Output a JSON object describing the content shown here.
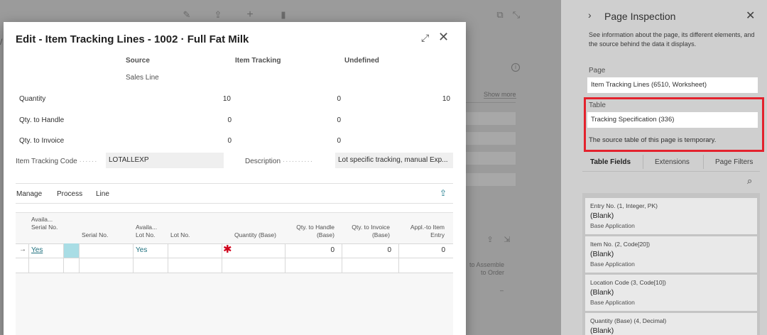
{
  "dialog": {
    "title": "Edit - Item Tracking Lines - 1002 · Full Fat Milk",
    "columns": {
      "source": "Source",
      "source_sub": "Sales Line",
      "item_tracking": "Item Tracking",
      "undefined": "Undefined"
    },
    "rows": [
      {
        "label": "Quantity",
        "source": "10",
        "item_tracking": "0",
        "undefined": "10"
      },
      {
        "label": "Qty. to Handle",
        "source": "0",
        "item_tracking": "0"
      },
      {
        "label": "Qty. to Invoice",
        "source": "0",
        "item_tracking": "0"
      }
    ],
    "item_tracking_code_label": "Item Tracking Code",
    "item_tracking_code_value": "LOTALLEXP",
    "description_label": "Description",
    "description_value": "Lot specific tracking, manual Exp...",
    "menu": [
      "Manage",
      "Process",
      "Line"
    ],
    "grid": {
      "headers": {
        "avail_serial": "Availa... Serial No.",
        "serial_no": "Serial No.",
        "avail_lot": "Availa... Lot No.",
        "lot_no": "Lot No.",
        "quantity_base": "Quantity (Base)",
        "qty_handle_base": "Qty. to Handle (Base)",
        "qty_invoice_base": "Qty. to Invoice (Base)",
        "appl_to_item_entry": "Appl.-to Item Entry"
      },
      "row1": {
        "avail_serial": "Yes",
        "avail_lot": "Yes",
        "qty_handle_base": "0",
        "qty_invoice_base": "0",
        "appl_to_item_entry": "0"
      }
    }
  },
  "background": {
    "show_more": "Show more",
    "assemble": "to Assemble to Order",
    "dash": "–"
  },
  "pane": {
    "title": "Page Inspection",
    "description": "See information about the page, its different elements, and the source behind the data it displays.",
    "page_label": "Page",
    "page_value": "Item Tracking Lines (6510, Worksheet)",
    "table_label": "Table",
    "table_value": "Tracking Specification (336)",
    "table_note": "The source table of this page is temporary.",
    "tabs": [
      "Table Fields",
      "Extensions",
      "Page Filters"
    ],
    "fields": [
      {
        "name": "Entry No. (1, Integer, PK)",
        "value": "(Blank)",
        "source": "Base Application"
      },
      {
        "name": "Item No. (2, Code[20])",
        "value": "(Blank)",
        "source": "Base Application"
      },
      {
        "name": "Location Code (3, Code[10])",
        "value": "(Blank)",
        "source": "Base Application"
      },
      {
        "name": "Quantity (Base) (4, Decimal)",
        "value": "(Blank)",
        "source": ""
      }
    ]
  },
  "colors": {
    "highlight": "#e3222d",
    "link": "#1e6f7d",
    "required": "#d0021b",
    "selected_cell": "#a9dde5"
  }
}
